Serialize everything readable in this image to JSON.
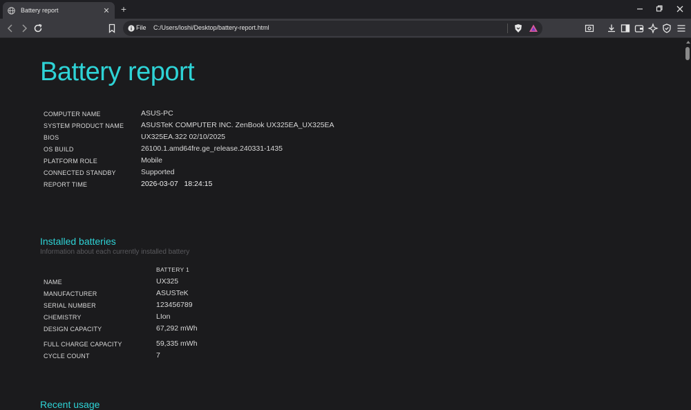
{
  "browser": {
    "tab": {
      "title": "Battery report"
    },
    "address_bar": {
      "scheme_label": "File",
      "url": "C:/Users/loshi/Desktop/battery-report.html"
    }
  },
  "report": {
    "title": "Battery report",
    "system_info": [
      {
        "label": "COMPUTER NAME",
        "value": "ASUS-PC"
      },
      {
        "label": "SYSTEM PRODUCT NAME",
        "value": "ASUSTeK COMPUTER INC. ZenBook UX325EA_UX325EA"
      },
      {
        "label": "BIOS",
        "value": "UX325EA.322 02/10/2025"
      },
      {
        "label": "OS BUILD",
        "value": "26100.1.amd64fre.ge_release.240331-1435"
      },
      {
        "label": "PLATFORM ROLE",
        "value": "Mobile"
      },
      {
        "label": "CONNECTED STANDBY",
        "value": "Supported"
      },
      {
        "label": "REPORT TIME",
        "value": "2026-03-07   18:24:15"
      }
    ],
    "installed_batteries": {
      "heading": "Installed batteries",
      "subheading": "Information about each currently installed battery",
      "column_header": "BATTERY 1",
      "rows": [
        {
          "label": "NAME",
          "value": "UX325"
        },
        {
          "label": "MANUFACTURER",
          "value": "ASUSTeK"
        },
        {
          "label": "SERIAL NUMBER",
          "value": "123456789"
        },
        {
          "label": "CHEMISTRY",
          "value": "LIon"
        },
        {
          "label": "DESIGN CAPACITY",
          "value": "67,292 mWh"
        },
        {
          "label": "FULL CHARGE CAPACITY",
          "value": "59,335 mWh"
        },
        {
          "label": "CYCLE COUNT",
          "value": "7"
        }
      ]
    },
    "recent_usage": {
      "heading": "Recent usage"
    }
  },
  "icons": {
    "favicon": "globe-icon",
    "tab_close": "close-icon",
    "new_tab": "plus-icon",
    "back": "chevron-left-icon",
    "forward": "chevron-right-icon",
    "reload": "reload-icon",
    "bookmark": "bookmark-icon",
    "site_info": "info-icon",
    "brave_shields": "lion-shield-icon",
    "brave_rewards": "triangle-rewards-icon",
    "toolbar_right": [
      "screenshot-icon",
      "download-icon",
      "sidebar-icon",
      "wallet-icon",
      "leo-ai-icon",
      "vpn-shield-icon",
      "menu-icon"
    ]
  },
  "colors": {
    "accent": "#2ed3d6",
    "background": "#1b1b1d",
    "toolbar": "#3a3a3f"
  }
}
